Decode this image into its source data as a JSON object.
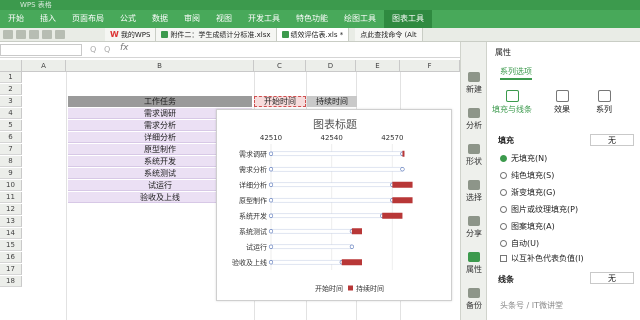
{
  "app": {
    "title": "WPS 表格"
  },
  "menu": [
    "开始",
    "插入",
    "页面布局",
    "公式",
    "数据",
    "审阅",
    "视图",
    "开发工具",
    "特色功能",
    "绘图工具",
    "图表工具"
  ],
  "doc_tabs": [
    {
      "label": "我的WPS"
    },
    {
      "label": "附件二：学生成绩计分标准.xlsx"
    },
    {
      "label": "绩效评估表.xls *"
    },
    {
      "label": "点此查找命令 (Alt"
    }
  ],
  "formula": {
    "fx": "fx",
    "btn1": "Q",
    "btn2": "Q"
  },
  "sheet": {
    "columns": [
      "A",
      "B",
      "C",
      "D",
      "E",
      "F"
    ],
    "rows": [
      "1",
      "2",
      "3",
      "4",
      "5",
      "6",
      "7",
      "8",
      "9",
      "10",
      "11",
      "12",
      "13",
      "14",
      "15",
      "16",
      "17",
      "18"
    ],
    "headers": {
      "task": "工作任务",
      "start": "开始时间",
      "duration": "持续时间"
    },
    "tasks": [
      "需求调研",
      "需求分析",
      "详细分析",
      "原型制作",
      "系统开发",
      "系统测试",
      "试运行",
      "验收及上线"
    ]
  },
  "chart_data": {
    "type": "bar",
    "title": "图表标题",
    "categories": [
      "需求调研",
      "需求分析",
      "详细分析",
      "原型制作",
      "系统开发",
      "系统测试",
      "试运行",
      "验收及上线"
    ],
    "series": [
      {
        "name": "开始时间",
        "values": [
          42575,
          42575,
          42570,
          42570,
          42565,
          42550,
          42550,
          42545
        ],
        "color": "#ffffff"
      },
      {
        "name": "持续时间",
        "values": [
          1,
          0,
          10,
          10,
          10,
          5,
          0,
          10
        ],
        "color": "#b83737"
      }
    ],
    "xaxis": {
      "ticks": [
        "42510",
        "42540",
        "42570"
      ],
      "range": [
        42510,
        42600
      ],
      "position": "top"
    },
    "legend": "bottom"
  },
  "tools": [
    "新建",
    "分析",
    "形状",
    "选择",
    "分享",
    "属性",
    "备份"
  ],
  "props": {
    "title": "属性",
    "series_select": "系列选项",
    "tabs": [
      "填充与线条",
      "效果",
      "系列"
    ],
    "fill_label": "填充",
    "fill_value": "无",
    "options": [
      "无填充(N)",
      "纯色填充(S)",
      "渐变填充(G)",
      "图片或纹理填充(P)",
      "图案填充(A)",
      "自动(U)"
    ],
    "invert": "以互补色代表负值(I)",
    "line_label": "线条",
    "line_value": "无"
  },
  "watermark": "头条号 / IT微讲堂"
}
